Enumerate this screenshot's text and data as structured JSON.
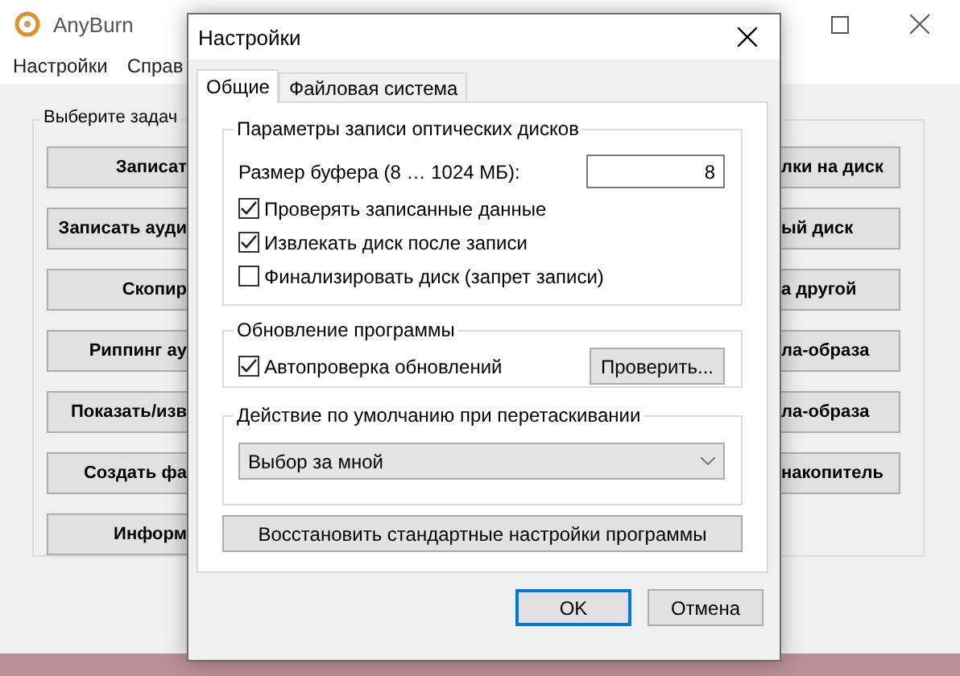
{
  "main_window": {
    "title": "AnyBurn",
    "menu": [
      "Настройки",
      "Справ"
    ],
    "group_label": "Выберите задач",
    "left_buttons": [
      "Записат",
      "Записать ауди",
      "Скопир",
      "Риппинг ау",
      "Показать/изв",
      "Создать фа",
      "Информ"
    ],
    "right_buttons": [
      "лки на диск",
      "ый диск",
      "а другой",
      "ла-образа",
      "ла-образа",
      "накопитель"
    ]
  },
  "dialog": {
    "title": "Настройки",
    "tabs": [
      {
        "label": "Общие",
        "selected": true
      },
      {
        "label": "Файловая система",
        "selected": false
      }
    ],
    "disc_group": {
      "title": "Параметры записи оптических дисков",
      "buffer_label": "Размер буфера (8 … 1024 МБ):",
      "buffer_value": "8",
      "options": [
        {
          "label": "Проверять записанные данные",
          "checked": true
        },
        {
          "label": "Извлекать диск после записи",
          "checked": true
        },
        {
          "label": "Финализировать диск (запрет записи)",
          "checked": false
        }
      ]
    },
    "update_group": {
      "title": "Обновление программы",
      "option": {
        "label": "Автопроверка обновлений",
        "checked": true
      },
      "button": "Проверить..."
    },
    "drag_group": {
      "title": "Действие по умолчанию при перетаскивании",
      "value": "Выбор за мной"
    },
    "restore_button": "Восстановить стандартные настройки программы",
    "buttons": [
      {
        "label": "OK",
        "default": true
      },
      {
        "label": "Отмена",
        "default": false
      }
    ]
  }
}
